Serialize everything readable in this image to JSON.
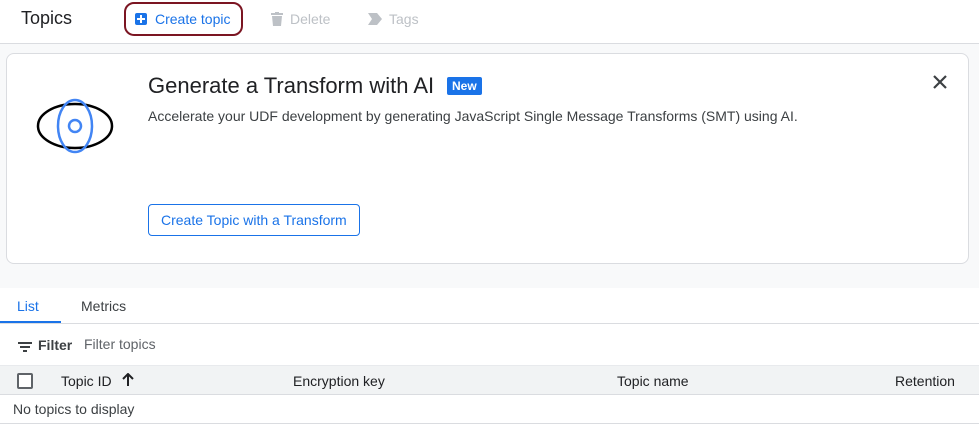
{
  "page": {
    "title": "Topics"
  },
  "toolbar": {
    "create_label": "Create topic",
    "delete_label": "Delete",
    "tags_label": "Tags"
  },
  "promo": {
    "title": "Generate a Transform with AI",
    "badge": "New",
    "description": "Accelerate your UDF development by generating JavaScript Single Message Transforms (SMT) using AI.",
    "button_label": "Create Topic with a Transform"
  },
  "tabs": [
    {
      "label": "List",
      "active": true
    },
    {
      "label": "Metrics",
      "active": false
    }
  ],
  "filter": {
    "label": "Filter",
    "placeholder": "Filter topics",
    "value": ""
  },
  "table": {
    "columns": [
      "Topic ID",
      "Encryption key",
      "Topic name",
      "Retention"
    ],
    "sort": {
      "column": "Topic ID",
      "direction": "ascending"
    },
    "empty_message": "No topics to display"
  },
  "colors": {
    "accent": "#1a73e8",
    "create_button_outline": "#7b1522",
    "disabled": "#bdc1c6"
  },
  "icons": {
    "create": "plus-box-icon",
    "delete": "trash-icon",
    "tags": "tag-icon",
    "promo": "eye-icon",
    "close": "close-icon",
    "filter": "filter-icon",
    "sort": "arrow-up-icon"
  }
}
